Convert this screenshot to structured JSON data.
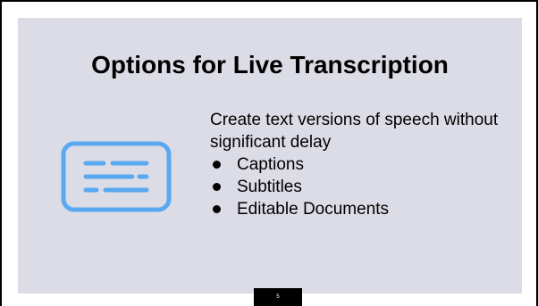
{
  "slide": {
    "title": "Options for Live Transcription",
    "body_text": "Create text versions of speech without significant delay",
    "bullets": [
      "Captions",
      "Subtitles",
      "Editable Documents"
    ],
    "icon": "subtitles-icon",
    "page_number": "5"
  },
  "colors": {
    "slide_background": "#dcdce6",
    "icon_accent": "#5aa9f0"
  }
}
